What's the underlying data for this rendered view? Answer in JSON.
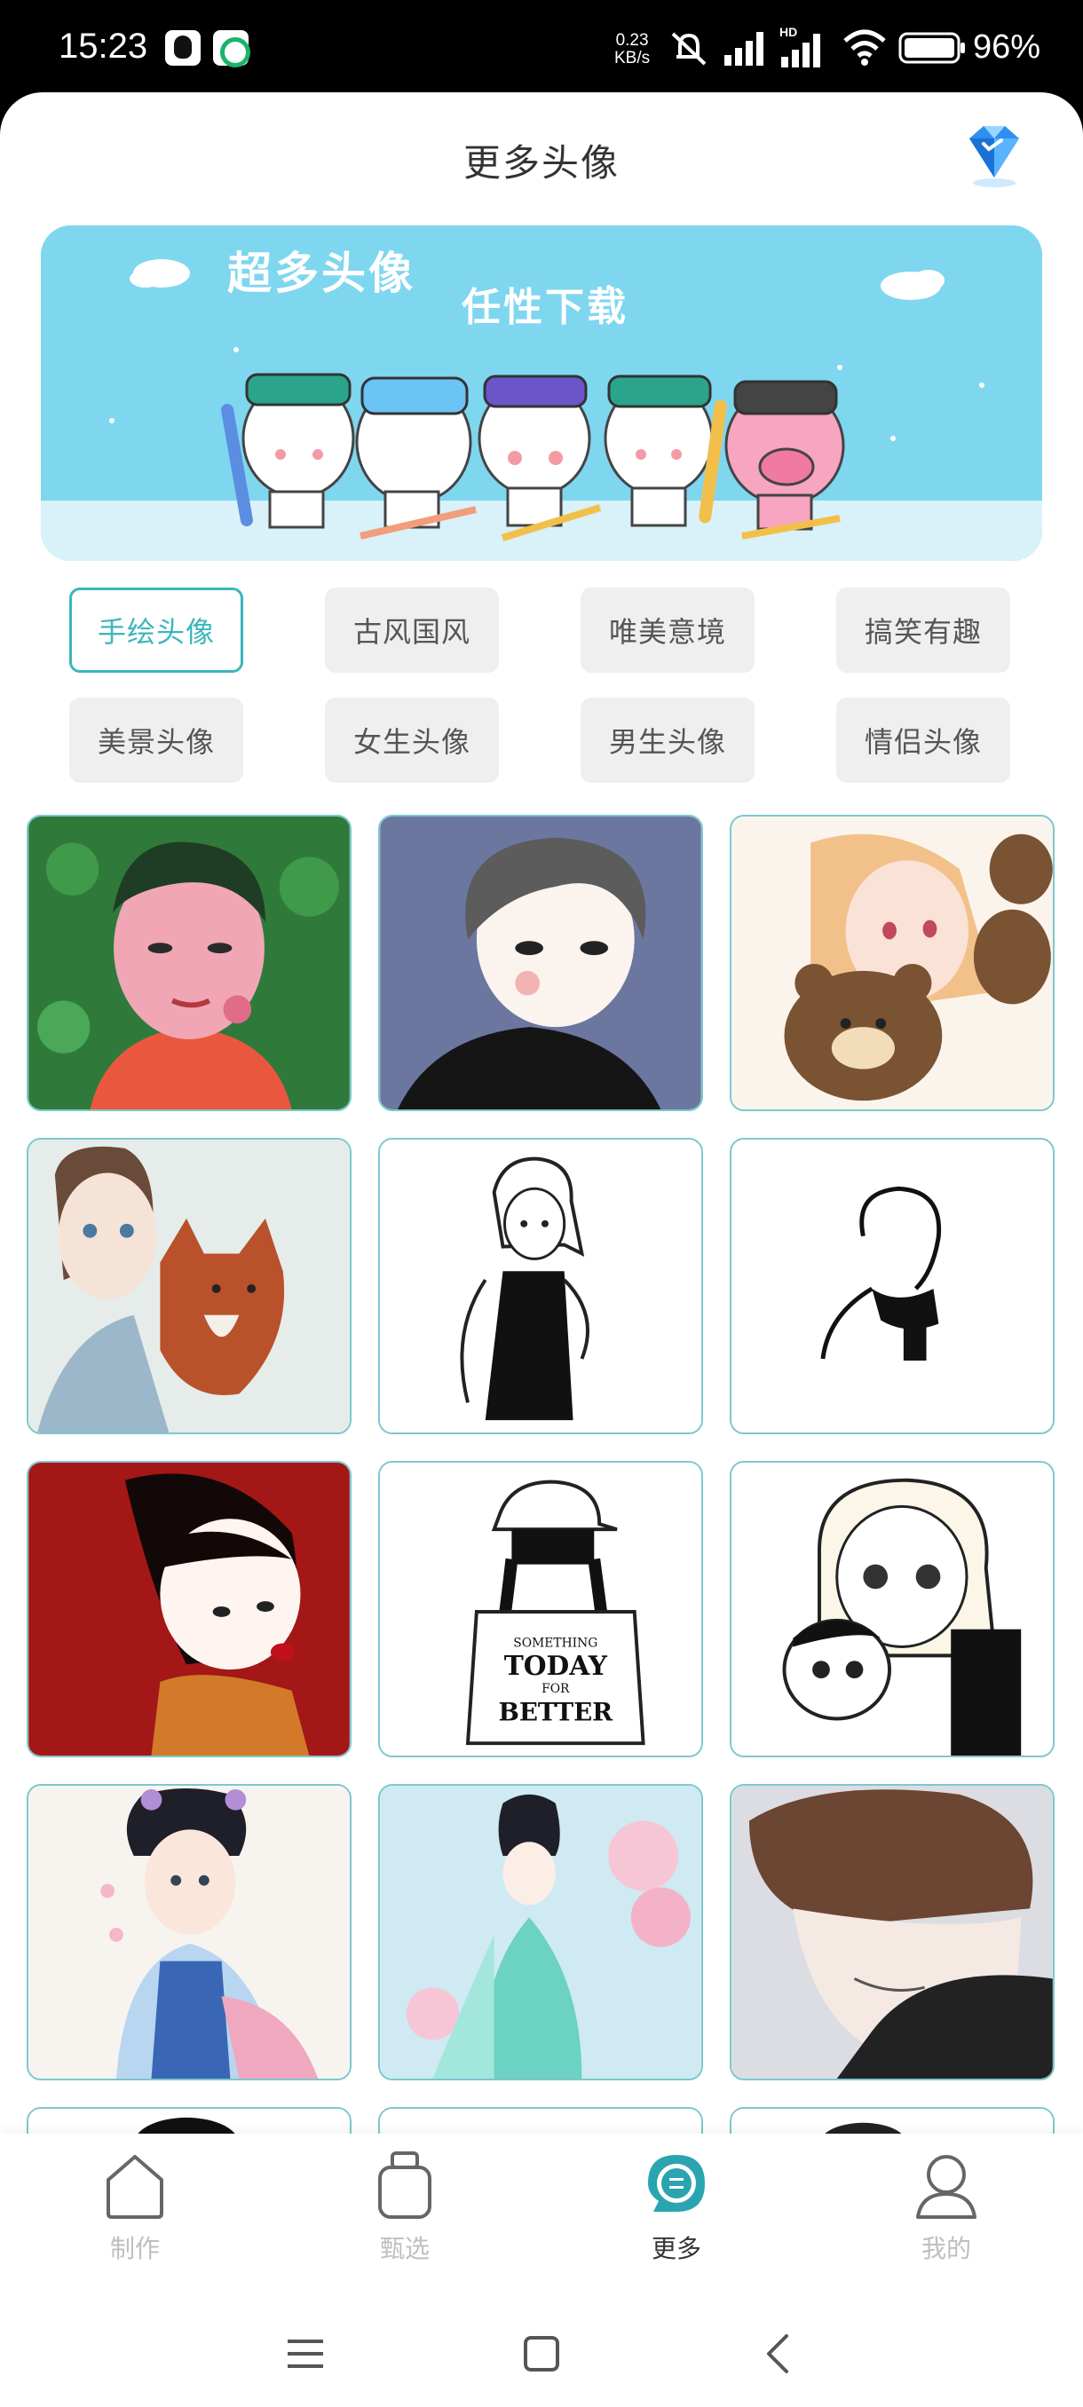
{
  "status_bar": {
    "time": "15:23",
    "net_speed_value": "0.23",
    "net_speed_unit": "KB/s",
    "network_label": "HD",
    "battery": "96%",
    "icons": [
      "qq-icon",
      "app-icon",
      "mute-icon",
      "signal-icon",
      "signal-hd-icon",
      "wifi-icon",
      "battery-icon"
    ]
  },
  "header": {
    "title": "更多头像",
    "vip_icon": "diamond-icon"
  },
  "banner": {
    "line1": "超多头像",
    "line2": "任性下载"
  },
  "categories": [
    {
      "label": "手绘头像",
      "active": true
    },
    {
      "label": "古风国风",
      "active": false
    },
    {
      "label": "唯美意境",
      "active": false
    },
    {
      "label": "搞笑有趣",
      "active": false
    },
    {
      "label": "美景头像",
      "active": false
    },
    {
      "label": "女生头像",
      "active": false
    },
    {
      "label": "男生头像",
      "active": false
    },
    {
      "label": "情侣头像",
      "active": false
    }
  ],
  "tile_shirt_text": "SOMETHING TODAY FOR BETTER",
  "nav": [
    {
      "label": "制作",
      "icon": "home-icon",
      "active": false
    },
    {
      "label": "甄选",
      "icon": "jar-icon",
      "active": false
    },
    {
      "label": "更多",
      "icon": "chat-more-icon",
      "active": true
    },
    {
      "label": "我的",
      "icon": "user-icon",
      "active": false
    }
  ],
  "colors": {
    "accent": "#3cb6bd",
    "banner_bg": "#7fd6ef",
    "chip_bg": "#efefef"
  }
}
